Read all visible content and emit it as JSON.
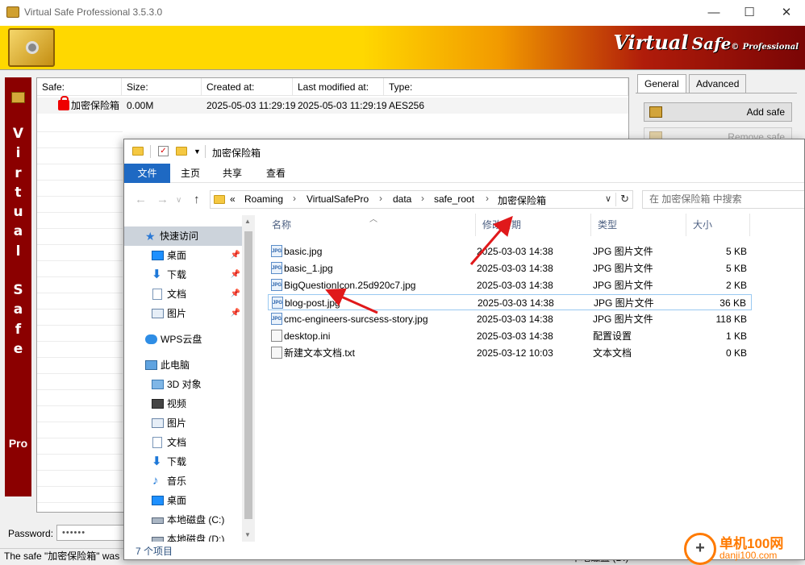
{
  "window": {
    "title": "Virtual Safe Professional 3.5.3.0",
    "minimize_glyph": "—",
    "maximize_glyph": "☐",
    "close_glyph": "✕"
  },
  "banner": {
    "brand_1": "Virtual",
    "brand_2": "Safe",
    "brand_reg": "©",
    "brand_3": "Professional"
  },
  "sidebar": {
    "letters": "V i r t u a l S a f e",
    "pro": "Pro"
  },
  "safes_table": {
    "columns": [
      "Safe:",
      "Size:",
      "Created at:",
      "Last modified at:",
      "Type:"
    ],
    "rows": [
      {
        "safe": "加密保险箱",
        "size": "0.00M",
        "created": "2025-05-03 11:29:19",
        "modified": "2025-05-03 11:29:19",
        "type": "AES256"
      }
    ]
  },
  "tabs": {
    "general": "General",
    "advanced": "Advanced"
  },
  "buttons": {
    "add_safe": "Add safe",
    "remove_safe": "Remove safe"
  },
  "password": {
    "label": "Password:",
    "value": "••••••"
  },
  "status": {
    "text": "The safe \"加密保险箱\" was",
    "drive": "本地磁盘 (D:)"
  },
  "explorer": {
    "title": "加密保险箱",
    "ribbon_tabs": [
      "文件",
      "主页",
      "共享",
      "查看"
    ],
    "breadcrumb": [
      "«",
      "Roaming",
      "VirtualSafePro",
      "data",
      "safe_root",
      "加密保险箱"
    ],
    "search_placeholder": "在 加密保险箱 中搜索",
    "nav": {
      "quick_access": "快速访问",
      "pinned": [
        "桌面",
        "下载",
        "文档",
        "图片"
      ],
      "wps": "WPS云盘",
      "this_pc": "此电脑",
      "pc_items": [
        "3D 对象",
        "视频",
        "图片",
        "文档",
        "下载",
        "音乐",
        "桌面",
        "本地磁盘 (C:)",
        "本地磁盘 (D:)"
      ]
    },
    "columns": {
      "name": "名称",
      "modified": "修改日期",
      "type": "类型",
      "size": "大小"
    },
    "files": [
      {
        "name": "basic.jpg",
        "modified": "2025-03-03 14:38",
        "type": "JPG 图片文件",
        "size": "5 KB",
        "icon": "jpg"
      },
      {
        "name": "basic_1.jpg",
        "modified": "2025-03-03 14:38",
        "type": "JPG 图片文件",
        "size": "5 KB",
        "icon": "jpg"
      },
      {
        "name": "BigQuestionIcon.25d920c7.jpg",
        "modified": "2025-03-03 14:38",
        "type": "JPG 图片文件",
        "size": "2 KB",
        "icon": "jpg"
      },
      {
        "name": "blog-post.jpg",
        "modified": "2025-03-03 14:38",
        "type": "JPG 图片文件",
        "size": "36 KB",
        "icon": "jpg"
      },
      {
        "name": "cmc-engineers-surcsess-story.jpg",
        "modified": "2025-03-03 14:38",
        "type": "JPG 图片文件",
        "size": "118 KB",
        "icon": "jpg"
      },
      {
        "name": "desktop.ini",
        "modified": "2025-03-03 14:38",
        "type": "配置设置",
        "size": "1 KB",
        "icon": "ini"
      },
      {
        "name": "新建文本文档.txt",
        "modified": "2025-03-12 10:03",
        "type": "文本文档",
        "size": "0 KB",
        "icon": "txt"
      }
    ],
    "item_count": "7 个项目"
  },
  "watermark": {
    "text": "单机100网",
    "url": "danji100.com"
  },
  "colors": {
    "accent_blue": "#1e69c3",
    "banner_yellow": "#ffd800",
    "banner_red": "#8b0000",
    "arrow_red": "#e0191b"
  }
}
